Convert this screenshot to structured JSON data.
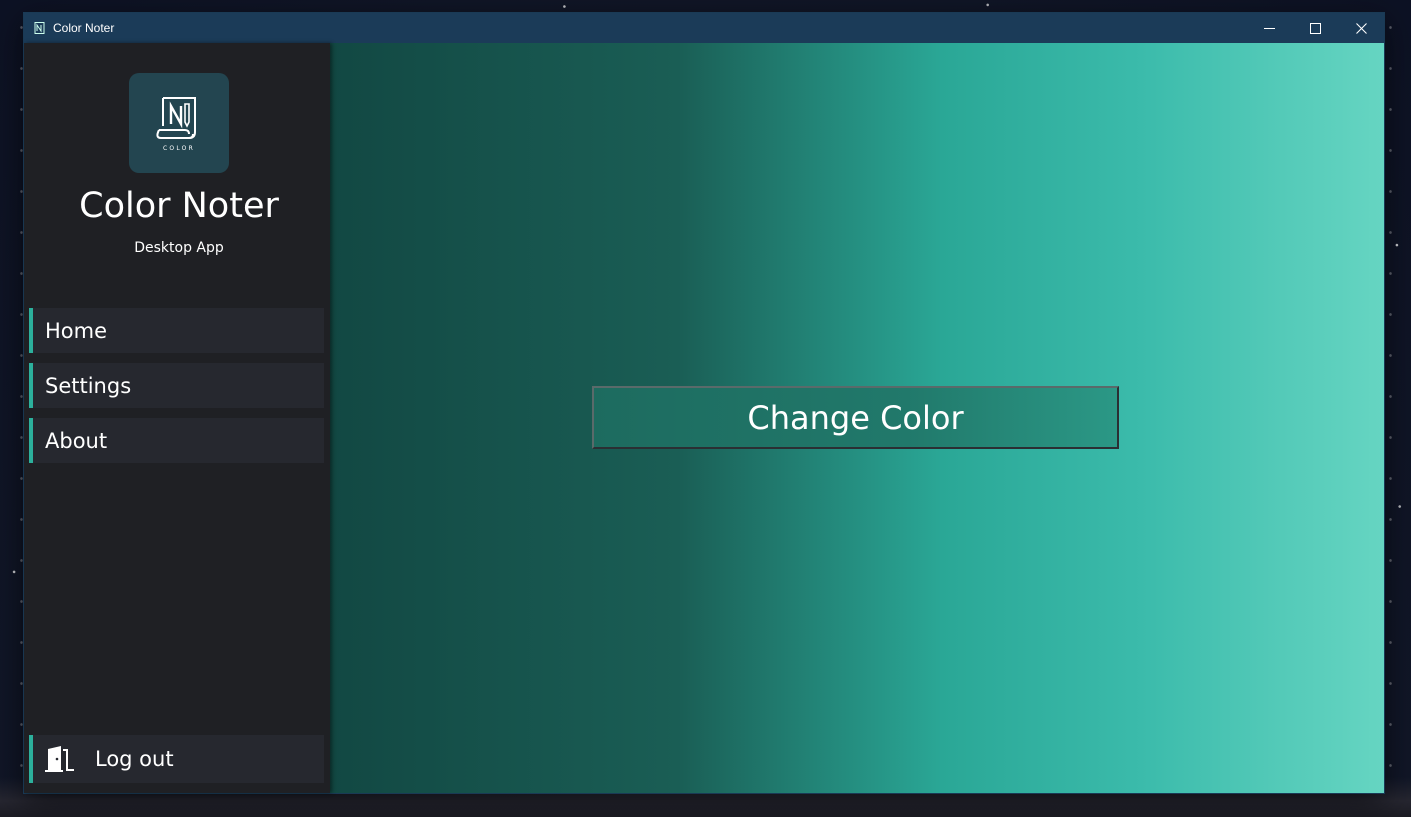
{
  "window": {
    "title": "Color Noter"
  },
  "sidebar": {
    "app_name": "Color Noter",
    "app_subtitle": "Desktop App",
    "logo_caption": "COLOR",
    "items": [
      {
        "label": "Home"
      },
      {
        "label": "Settings"
      },
      {
        "label": "About"
      }
    ],
    "logout_label": "Log out"
  },
  "main": {
    "change_color_label": "Change Color"
  },
  "colors": {
    "titlebar": "#1b3b58",
    "sidebar_bg": "#1f2024",
    "nav_item_bg": "#26282f",
    "accent": "#2cb09c",
    "logo_bg": "#234550",
    "gradient_start": "#124843",
    "gradient_end": "#66d5c2"
  },
  "icons": {
    "app": "notebook-icon",
    "logo": "notebook-pen-logo",
    "logout": "door-exit-icon",
    "minimize": "minimize-icon",
    "maximize": "maximize-icon",
    "close": "close-icon"
  }
}
